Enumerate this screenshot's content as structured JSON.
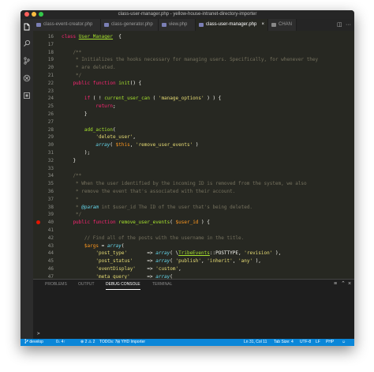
{
  "window": {
    "title": "class-user-manager.php - yellow-house-intranet-directory-importer"
  },
  "tabs": [
    {
      "label": "class-event-creator.php"
    },
    {
      "label": "class-generator.php"
    },
    {
      "label": "view.php"
    },
    {
      "label": "class-user-manager.php",
      "close": "×"
    },
    {
      "label": "CHAN"
    }
  ],
  "tab_actions": {
    "split": "◫",
    "more": "···"
  },
  "editor": {
    "lines": [
      {
        "num": "16",
        "tokens": [
          [
            "kw",
            "class "
          ],
          [
            "cl",
            "User_Manager"
          ],
          [
            "",
            "  {"
          ]
        ]
      },
      {
        "num": "17",
        "tokens": []
      },
      {
        "num": "18",
        "tokens": [
          [
            "c",
            "    /**"
          ]
        ]
      },
      {
        "num": "19",
        "tokens": [
          [
            "c",
            "     * Initializes the hooks necessary for managing users. Specifically, for whenever they"
          ]
        ]
      },
      {
        "num": "20",
        "tokens": [
          [
            "c",
            "     * are deleted."
          ]
        ]
      },
      {
        "num": "21",
        "tokens": [
          [
            "c",
            "     */"
          ]
        ]
      },
      {
        "num": "22",
        "tokens": [
          [
            "kw",
            "    public function "
          ],
          [
            "f",
            "init"
          ],
          [
            "",
            "() {"
          ]
        ]
      },
      {
        "num": "23",
        "tokens": []
      },
      {
        "num": "24",
        "tokens": [
          [
            "kw",
            "        if"
          ],
          [
            "",
            " ( ! "
          ],
          [
            "f",
            "current_user_can"
          ],
          [
            "",
            " ( "
          ],
          [
            "s",
            "'manage_options'"
          ],
          [
            "",
            " ) ) {"
          ]
        ]
      },
      {
        "num": "25",
        "tokens": [
          [
            "kw",
            "            return"
          ],
          [
            "",
            ";"
          ]
        ]
      },
      {
        "num": "26",
        "tokens": [
          [
            "",
            "        }"
          ]
        ]
      },
      {
        "num": "27",
        "tokens": []
      },
      {
        "num": "28",
        "tokens": [
          [
            "f",
            "        add_action"
          ],
          [
            "",
            "("
          ]
        ]
      },
      {
        "num": "29",
        "tokens": [
          [
            "s",
            "            'delete_user'"
          ],
          [
            "",
            ","
          ]
        ]
      },
      {
        "num": "30",
        "tokens": [
          [
            "k",
            "            array"
          ],
          [
            "",
            "( "
          ],
          [
            "v",
            "$this"
          ],
          [
            "",
            ", "
          ],
          [
            "s",
            "'remove_user_events'"
          ],
          [
            "",
            " )"
          ]
        ]
      },
      {
        "num": "31",
        "tokens": [
          [
            "",
            "        );"
          ]
        ]
      },
      {
        "num": "32",
        "tokens": [
          [
            "",
            "    }"
          ]
        ]
      },
      {
        "num": "33",
        "tokens": []
      },
      {
        "num": "34",
        "tokens": [
          [
            "c",
            "    /**"
          ]
        ]
      },
      {
        "num": "35",
        "tokens": [
          [
            "c",
            "     * When the user identified by the incoming ID is removed from the system, we also"
          ]
        ]
      },
      {
        "num": "36",
        "tokens": [
          [
            "c",
            "     * remove the event that's associated with their account."
          ]
        ]
      },
      {
        "num": "37",
        "tokens": [
          [
            "c",
            "     *"
          ]
        ]
      },
      {
        "num": "38",
        "tokens": [
          [
            "c",
            "     * "
          ],
          [
            "k",
            "@param"
          ],
          [
            "c",
            " int $user_id The ID of the user that's being deleted."
          ]
        ]
      },
      {
        "num": "39",
        "tokens": [
          [
            "c",
            "     */"
          ]
        ]
      },
      {
        "num": "40",
        "tokens": [
          [
            "kw",
            "    public function "
          ],
          [
            "f",
            "remove_user_events"
          ],
          [
            "",
            "( "
          ],
          [
            "v",
            "$user_id"
          ],
          [
            "",
            " ) {"
          ]
        ],
        "breakpoint": true
      },
      {
        "num": "41",
        "tokens": []
      },
      {
        "num": "42",
        "tokens": [
          [
            "c",
            "        // Find all of the posts with the username in the title."
          ]
        ]
      },
      {
        "num": "43",
        "tokens": [
          [
            "v",
            "        $args"
          ],
          [
            "",
            " = "
          ],
          [
            "k",
            "array"
          ],
          [
            "",
            "("
          ]
        ]
      },
      {
        "num": "44",
        "tokens": [
          [
            "s",
            "            'post_type'"
          ],
          [
            "",
            "       => "
          ],
          [
            "k",
            "array"
          ],
          [
            "",
            "( \\"
          ],
          [
            "cl",
            "TribeEvents"
          ],
          [
            "",
            "::POSTTYPE, "
          ],
          [
            "s",
            "'revision'"
          ],
          [
            "",
            " ),"
          ]
        ]
      },
      {
        "num": "45",
        "tokens": [
          [
            "s",
            "            'post_status'"
          ],
          [
            "",
            "     => "
          ],
          [
            "k",
            "array"
          ],
          [
            "",
            "( "
          ],
          [
            "s",
            "'publish'"
          ],
          [
            "",
            ", "
          ],
          [
            "s",
            "'inherit'"
          ],
          [
            "",
            ", "
          ],
          [
            "s",
            "'any'"
          ],
          [
            "",
            " ),"
          ]
        ]
      },
      {
        "num": "46",
        "tokens": [
          [
            "s",
            "            'eventDisplay'"
          ],
          [
            "",
            "    => "
          ],
          [
            "s",
            "'custom'"
          ],
          [
            "",
            ","
          ]
        ]
      },
      {
        "num": "47",
        "tokens": [
          [
            "s",
            "            'meta_query'"
          ],
          [
            "",
            "      => "
          ],
          [
            "k",
            "array"
          ],
          [
            "",
            "("
          ]
        ]
      }
    ]
  },
  "panel": {
    "tabs": [
      "PROBLEMS",
      "OUTPUT",
      "DEBUG CONSOLE",
      "TERMINAL"
    ],
    "active_tab": "DEBUG CONSOLE",
    "actions": {
      "clear": "≡",
      "split": "⌃",
      "close": "×"
    },
    "prompt": ">"
  },
  "status": {
    "branch": "develop",
    "sync": "0↓ 4↑",
    "errors": "2",
    "warnings": "2",
    "todos": "TODOs: 7",
    "extension": "YHD Importer",
    "position": "Ln 31, Col 11",
    "tab_size": "Tab Size: 4",
    "encoding": "UTF-8",
    "eol": "LF",
    "language": "PHP",
    "feedback": "☺"
  },
  "colors": {
    "status_bar": "#0a86d8",
    "editor_bg": "#272822",
    "breakpoint": "#e51400"
  }
}
